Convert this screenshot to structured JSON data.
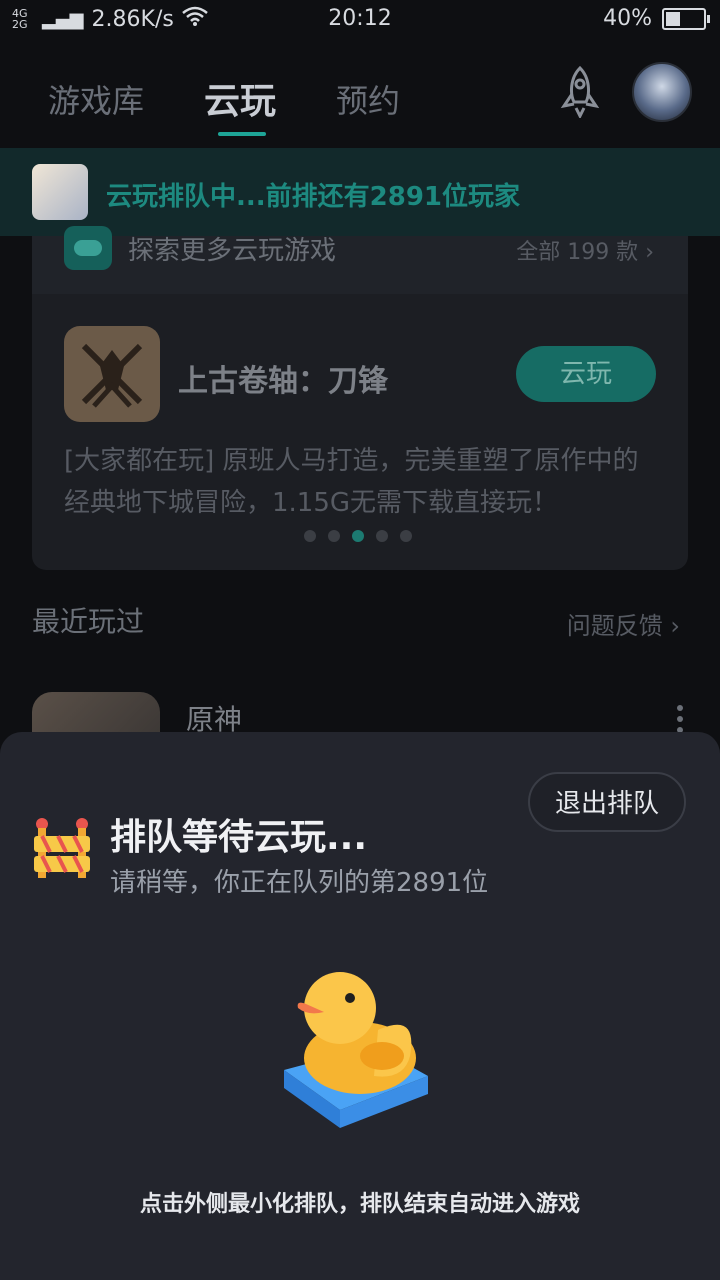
{
  "status_bar": {
    "network": "4G 2G",
    "speed": "2.86K/s",
    "time": "20:12",
    "battery": "40%"
  },
  "nav": {
    "tabs": [
      "游戏库",
      "云玩",
      "预约"
    ],
    "active_tab": "云玩"
  },
  "queue_banner": {
    "text": "云玩排队中...前排还有2891位玩家"
  },
  "explore_card": {
    "title": "探索更多云玩游戏",
    "count_label": "全部 199 款",
    "game_title": "上古卷轴：刀锋",
    "play_label": "云玩",
    "description": "[大家都在玩] 原班人马打造，完美重塑了原作中的经典地下城冒险，1.15G无需下载直接玩！",
    "active_dot": 2,
    "dot_count": 5
  },
  "recent": {
    "heading": "最近玩过",
    "feedback_label": "问题反馈",
    "items": [
      {
        "name": "原神"
      }
    ]
  },
  "queue_sheet": {
    "title": "排队等待云玩...",
    "subtitle": "请稍等，你正在队列的第2891位",
    "exit_label": "退出排队",
    "hint": "点击外侧最小化排队，排队结束自动进入游戏"
  },
  "colors": {
    "accent": "#1ea597",
    "sheet_bg": "#23252d",
    "page_bg": "#0e0f12"
  }
}
